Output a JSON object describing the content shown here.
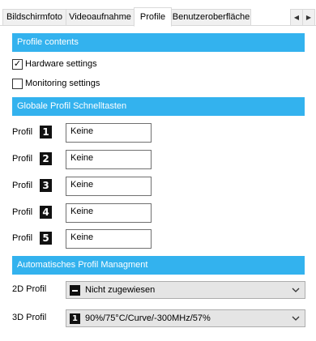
{
  "tabs": [
    {
      "label": "Bildschirmfoto",
      "active": false
    },
    {
      "label": "Videoaufnahme",
      "active": false
    },
    {
      "label": "Profile",
      "active": true
    },
    {
      "label": "Benutzeroberfläche",
      "active": false
    }
  ],
  "tab_scroll": {
    "left_icon": "chevron-left-icon",
    "right_icon": "chevron-right-icon",
    "left_glyph": "◀",
    "right_glyph": "▶"
  },
  "profile_contents": {
    "header": "Profile contents",
    "hardware": {
      "label": "Hardware settings",
      "checked": true,
      "mark": "✓"
    },
    "monitoring": {
      "label": "Monitoring settings",
      "checked": false
    }
  },
  "hotkeys": {
    "header": "Globale Profil Schnelltasten",
    "label": "Profil",
    "rows": [
      {
        "number": "1",
        "value": "Keine"
      },
      {
        "number": "2",
        "value": "Keine"
      },
      {
        "number": "3",
        "value": "Keine"
      },
      {
        "number": "4",
        "value": "Keine"
      },
      {
        "number": "5",
        "value": "Keine"
      }
    ]
  },
  "auto": {
    "header": "Automatisches Profil Managment",
    "profile_2d": {
      "label": "2D Profil",
      "value": "Nicht zugewiesen",
      "icon": "dash-icon"
    },
    "profile_3d": {
      "label": "3D Profil",
      "value": "90%/75°C/Curve/-300MHz/57%",
      "icon_number": "1"
    }
  },
  "colors": {
    "section_header": "#33b2ee",
    "tab_bg": "#f0f0f0",
    "border": "#d9d9d9"
  }
}
